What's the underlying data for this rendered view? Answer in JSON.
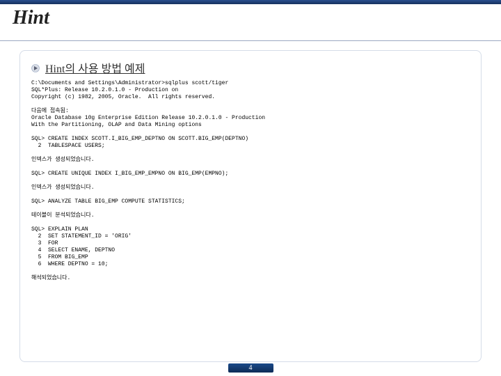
{
  "title": "Hint",
  "subtitle": "Hint의 사용 방법 예제",
  "code_lines": [
    "C:\\Documents and Settings\\Administrator>sqlplus scott/tiger",
    "SQL*Plus: Release 10.2.0.1.0 - Production on",
    "Copyright (c) 1982, 2005, Oracle.  All rights reserved.",
    "",
    "다음에 접속됨:",
    "Oracle Database 10g Enterprise Edition Release 10.2.0.1.0 - Production",
    "With the Partitioning, OLAP and Data Mining options",
    "",
    "SQL> CREATE INDEX SCOTT.I_BIG_EMP_DEPTNO ON SCOTT.BIG_EMP(DEPTNO)",
    "  2  TABLESPACE USERS;",
    "",
    "인덱스가 생성되었습니다.",
    "",
    "SQL> CREATE UNIQUE INDEX I_BIG_EMP_EMPNO ON BIG_EMP(EMPNO);",
    "",
    "인덱스가 생성되었습니다.",
    "",
    "SQL> ANALYZE TABLE BIG_EMP COMPUTE STATISTICS;",
    "",
    "테이블이 분석되었습니다.",
    "",
    "SQL> EXPLAIN PLAN",
    "  2  SET STATEMENT_ID = 'ORIG'",
    "  3  FOR",
    "  4  SELECT ENAME, DEPTNO",
    "  5  FROM BIG_EMP",
    "  6  WHERE DEPTNO = 10;",
    "",
    "해석되었습니다."
  ],
  "page_number": "4"
}
